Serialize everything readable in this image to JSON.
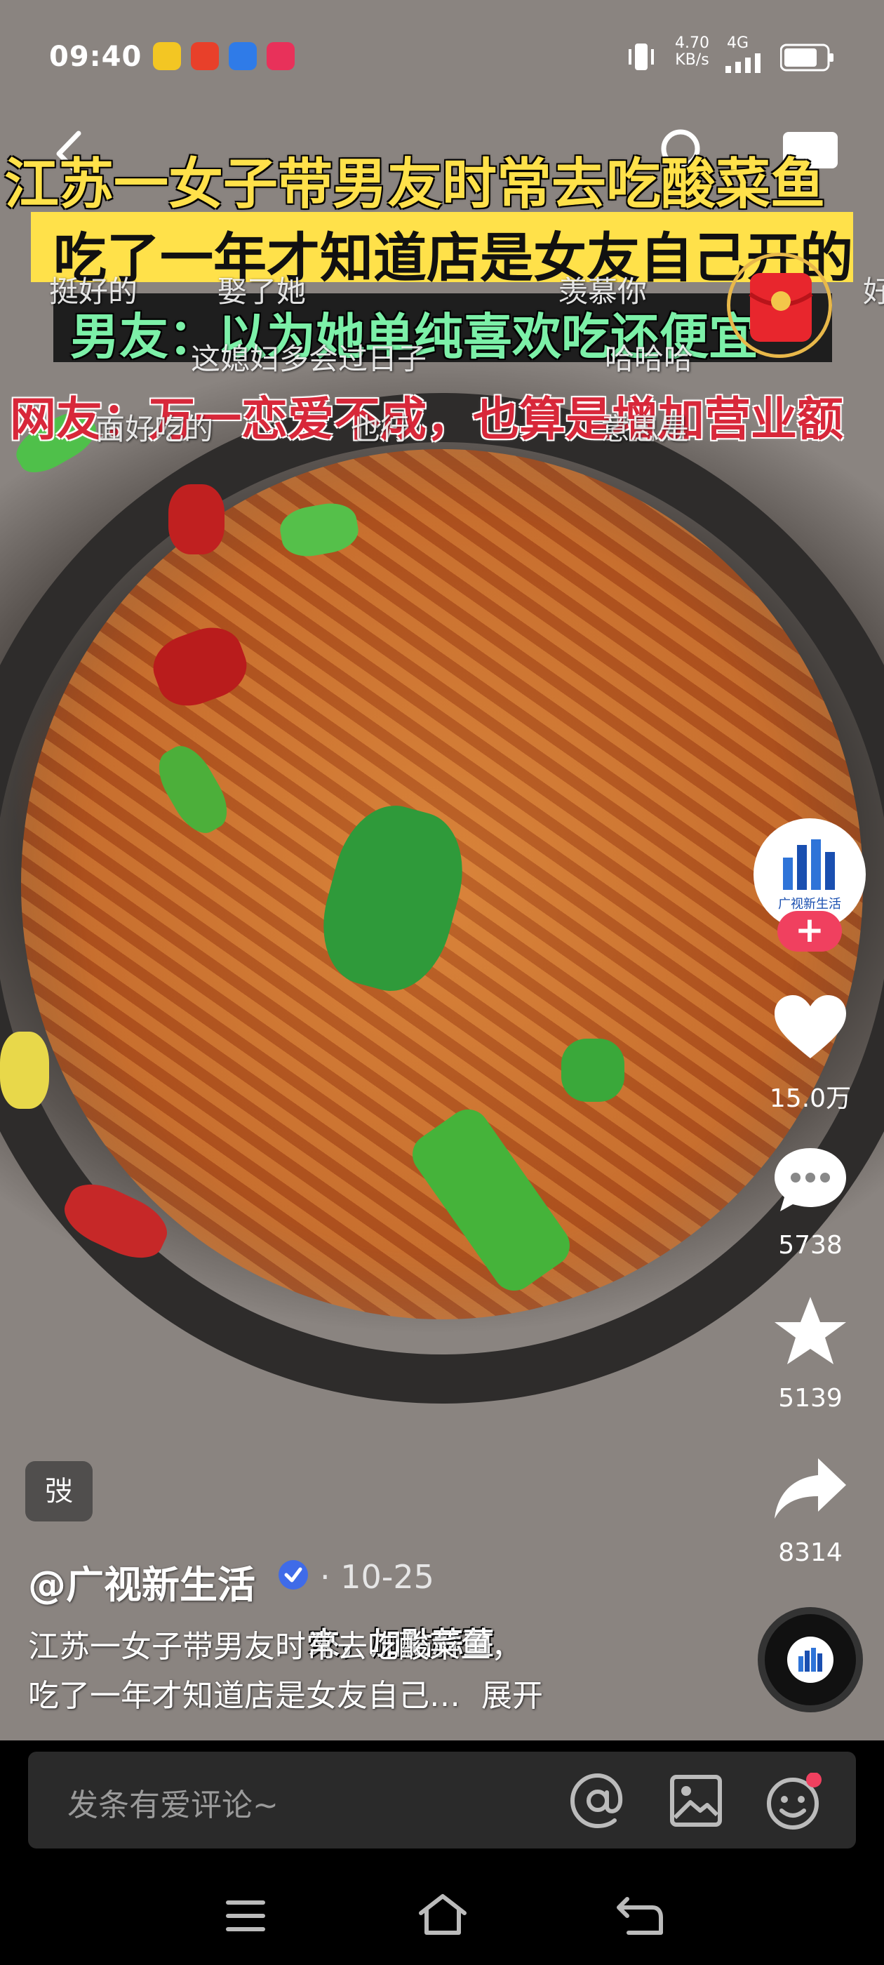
{
  "status_bar": {
    "time": "09:40",
    "network_speed_value": "4.70",
    "network_speed_unit": "KB/s",
    "network_type": "4G",
    "app_icons": [
      "weibo-icon",
      "tmall-icon",
      "browser-icon",
      "video-app-icon"
    ]
  },
  "video": {
    "headline_line1": "江苏一女子带男友时常去吃酸菜鱼",
    "headline_line2": "吃了一年才知道店是女友自己开的",
    "headline_line3": "男友：以为她单纯喜欢吃还便宜",
    "headline_line4": "网友：万一恋爱不成，也算是增加营业额",
    "subtitle": "來，加點蒜薑",
    "danmaku": [
      "挺好的",
      "娶了她",
      "羡慕你",
      "这媳妇多会过日子",
      "哈哈哈",
      "面好吃的",
      "也行",
      "意思是",
      "好"
    ]
  },
  "actions": {
    "avatar_label": "广视新生活",
    "like_count": "15.0万",
    "comment_count": "5738",
    "favorite_count": "5139",
    "share_count": "8314"
  },
  "post": {
    "tag_badge": "弢",
    "author": "@广视新生活",
    "date": "· 10-25",
    "caption_line1": "江苏一女子带男友时常去吃酸菜鱼，",
    "caption_line2": "吃了一年才知道店是女友自己…",
    "expand_label": "展开"
  },
  "comment_bar": {
    "placeholder": "发条有爱评论~"
  },
  "colors": {
    "headline_yellow": "#FFE14A",
    "headline_green": "#7CF0A8",
    "headline_red": "#D8283A",
    "verified_blue": "#3F6BE8",
    "follow_pink": "#F0405F"
  }
}
